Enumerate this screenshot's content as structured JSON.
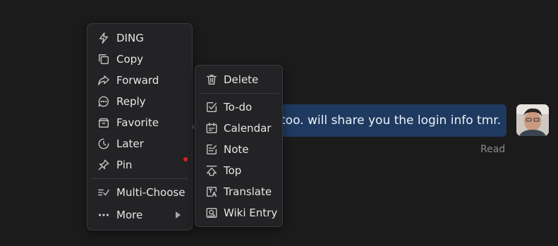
{
  "main_menu": {
    "items": [
      {
        "label": "DING",
        "icon": "lightning-icon"
      },
      {
        "label": "Copy",
        "icon": "copy-icon"
      },
      {
        "label": "Forward",
        "icon": "forward-icon"
      },
      {
        "label": "Reply",
        "icon": "reply-icon"
      },
      {
        "label": "Favorite",
        "icon": "favorite-icon"
      },
      {
        "label": "Later",
        "icon": "clock-icon"
      },
      {
        "label": "Pin",
        "icon": "pin-icon"
      },
      {
        "label": "Multi-Choose",
        "icon": "multi-choose-icon"
      },
      {
        "label": "More",
        "icon": "more-icon"
      }
    ]
  },
  "more_menu": {
    "items": [
      {
        "label": "Delete",
        "icon": "trash-icon"
      },
      {
        "label": "To-do",
        "icon": "todo-icon"
      },
      {
        "label": "Calendar",
        "icon": "calendar-icon"
      },
      {
        "label": "Note",
        "icon": "note-icon"
      },
      {
        "label": "Top",
        "icon": "top-icon"
      },
      {
        "label": "Translate",
        "icon": "translate-icon"
      },
      {
        "label": "Wiki Entry",
        "icon": "wiki-icon"
      }
    ]
  },
  "message": {
    "text": "too. will share you the login info tmr.",
    "status": "Read"
  },
  "colors": {
    "background": "#1b1b1c",
    "menu_bg": "#232325",
    "bubble": "#1f3a60",
    "unread_dot": "#e01e1e"
  }
}
